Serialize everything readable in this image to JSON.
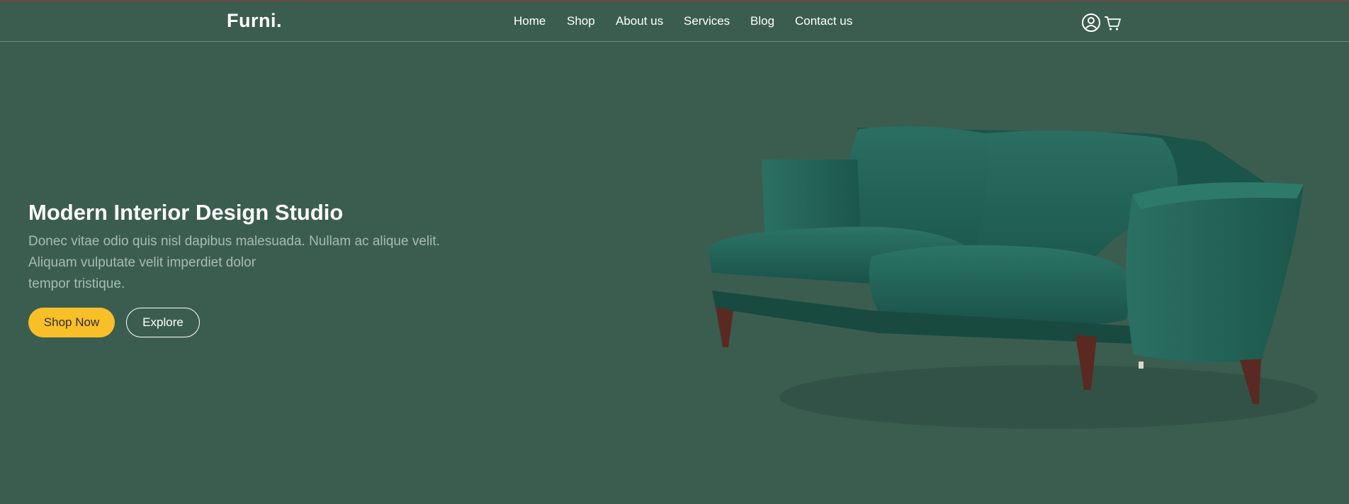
{
  "brand": {
    "name": "Furni."
  },
  "nav": {
    "items": [
      {
        "label": "Home"
      },
      {
        "label": "Shop"
      },
      {
        "label": "About us"
      },
      {
        "label": "Services"
      },
      {
        "label": "Blog"
      },
      {
        "label": "Contact us"
      }
    ],
    "icons": [
      "user-icon",
      "cart-icon"
    ]
  },
  "hero": {
    "title": "Modern Interior Design Studio",
    "text_lines": [
      "Donec vitae odio quis nisl dapibus malesuada. Nullam ac alique velit.",
      "Aliquam vulputate velit imperdiet dolor",
      "tempor tristique."
    ],
    "primary_button": "Shop Now",
    "secondary_button": "Explore",
    "image": "green-velvet-sofa"
  },
  "colors": {
    "background": "#3b5d50",
    "accent": "#f9bf29",
    "muted_text": "#a8bbb3",
    "sofa": "#1f5e52"
  }
}
